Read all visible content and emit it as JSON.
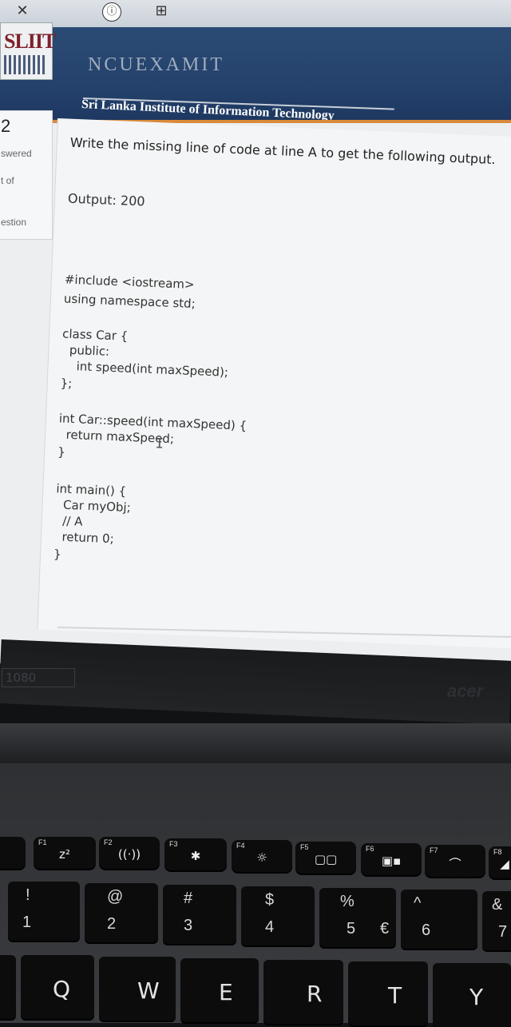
{
  "browser": {
    "close_glyph": "✕",
    "info_glyph": "ⓘ",
    "tab_glyph": "⊞"
  },
  "header": {
    "logo_text": "SLIIT",
    "brand_faded": "NCUEXAMIT",
    "institute_name": "Sri Lanka Institute of Information Technology"
  },
  "question_panel": {
    "number": "2",
    "line1": "swered",
    "line2": "t of",
    "line3": "estion"
  },
  "question": {
    "prompt": "Write the missing line of code at line A to get the following output.",
    "output": "Output: 200",
    "code": [
      "#include <iostream>",
      "using namespace std;",
      "class Car {",
      "  public:",
      "    int speed(int maxSpeed);",
      "};",
      "int Car::speed(int maxSpeed) {",
      "  return maxSpeed;",
      "}",
      "int main() {",
      "  Car myObj;",
      "  // A",
      "  return 0;",
      "}"
    ]
  },
  "laptop": {
    "bezel_badge": "1080",
    "brand": "acer",
    "fn_keys": [
      {
        "label": "F1",
        "glyph": "z²"
      },
      {
        "label": "F2",
        "glyph": "((·))"
      },
      {
        "label": "F3",
        "glyph": "✱"
      },
      {
        "label": "F4",
        "glyph": "☼"
      },
      {
        "label": "F5",
        "glyph": "▢▢"
      },
      {
        "label": "F6",
        "glyph": "▣▪"
      },
      {
        "label": "F7",
        "glyph": "⌒"
      },
      {
        "label": "F8",
        "glyph": "◢"
      }
    ],
    "number_keys": [
      {
        "top": "!",
        "bottom": "1",
        "side": ""
      },
      {
        "top": "@",
        "bottom": "2",
        "side": ""
      },
      {
        "top": "#",
        "bottom": "3",
        "side": ""
      },
      {
        "top": "$",
        "bottom": "4",
        "side": ""
      },
      {
        "top": "%",
        "bottom": "5",
        "side": "€"
      },
      {
        "top": "^",
        "bottom": "6",
        "side": ""
      },
      {
        "top": "&",
        "bottom": "7",
        "side": ""
      }
    ],
    "letter_keys": [
      "Q",
      "W",
      "E",
      "R",
      "T",
      "Y"
    ]
  }
}
